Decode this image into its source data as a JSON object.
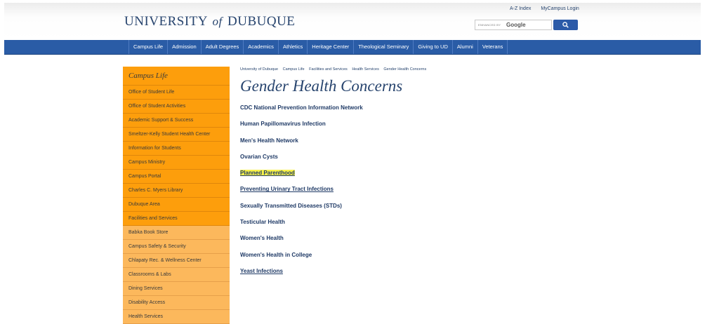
{
  "header": {
    "logo": {
      "part1": "UNIVERSITY",
      "part2": "of",
      "part3": "DUBUQUE"
    },
    "util_links": [
      "A-Z Index",
      "MyCampus Login"
    ],
    "search": {
      "powered_by": "ENHANCED BY",
      "brand": "Google"
    }
  },
  "nav": {
    "items": [
      "Campus Life",
      "Admission",
      "Adult Degrees",
      "Academics",
      "Athletics",
      "Heritage Center",
      "Theological Seminary",
      "Giving to UD",
      "Alumni",
      "Veterans"
    ]
  },
  "sidebar": {
    "title": "Campus Life",
    "items": [
      "Office of Student Life",
      "Office of Student Activities",
      "Academic Support & Success",
      "Smeltzer-Kelly Student Health Center",
      "Information for Students",
      "Campus Ministry",
      "Campus Portal",
      "Charles C. Myers Library",
      "Dubuque Area",
      "Facilities and Services",
      "Babka Book Store",
      "Campus Safety & Security",
      "Chlapaty Rec. & Wellness Center",
      "Classrooms & Labs",
      "Dining Services",
      "Disability Access",
      "Health Services"
    ]
  },
  "breadcrumb": [
    "University of Dubuque",
    "Campus Life",
    "Facilities and Services",
    "Health Services",
    "Gender Health Concerns"
  ],
  "main": {
    "title": "Gender Health Concerns",
    "links": [
      "CDC National Prevention Information Network",
      "Human Papillomavirus Infection",
      "Men's Health Network",
      "Ovarian Cysts",
      "Planned Parenthood",
      "Preventing Urinary Tract Infections",
      "Sexually Transmitted Diseases (STDs)",
      "Testicular Health",
      "Women's Health",
      "Women's Health in College",
      "Yeast Infections"
    ]
  }
}
